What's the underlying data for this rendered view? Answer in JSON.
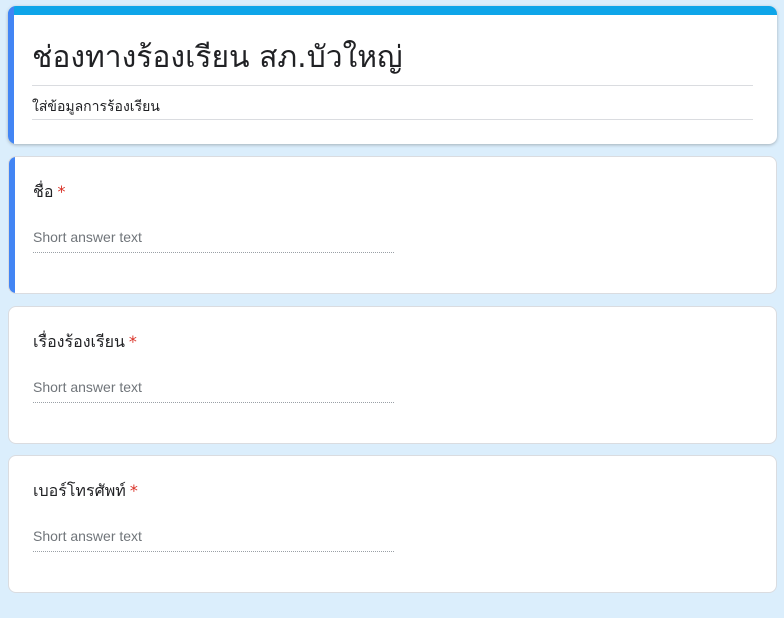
{
  "form": {
    "title": "ช่องทางร้องเรียน สภ.บัวใหญ่",
    "description": "ใส่ข้อมูลการร้องเรียน"
  },
  "questions": [
    {
      "label": "ชื่อ",
      "required_mark": "*",
      "placeholder": "Short answer text"
    },
    {
      "label": "เรื่องร้องเรียน",
      "required_mark": "*",
      "placeholder": "Short answer text"
    },
    {
      "label": "เบอร์โทรศัพท์",
      "required_mark": "*",
      "placeholder": "Short answer text"
    }
  ],
  "colors": {
    "background": "#dbeefc",
    "theme_bar": "#0ea5e9",
    "focus_accent": "#4285f4",
    "required": "#d93025"
  }
}
